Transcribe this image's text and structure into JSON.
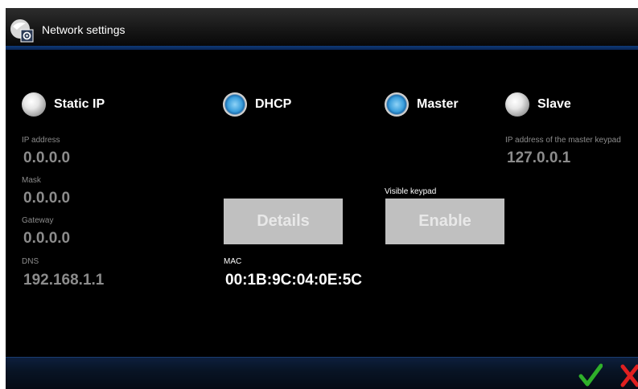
{
  "window": {
    "title": "Network settings"
  },
  "mode": {
    "static_ip": {
      "label": "Static IP",
      "selected": false
    },
    "dhcp": {
      "label": "DHCP",
      "selected": true
    }
  },
  "role": {
    "master": {
      "label": "Master",
      "selected": true
    },
    "slave": {
      "label": "Slave",
      "selected": false
    }
  },
  "fields": {
    "ip_address": {
      "label": "IP address",
      "value": "0.0.0.0"
    },
    "mask": {
      "label": "Mask",
      "value": "0.0.0.0"
    },
    "gateway": {
      "label": "Gateway",
      "value": "0.0.0.0"
    },
    "dns": {
      "label": "DNS",
      "value": "192.168.1.1"
    },
    "mac": {
      "label": "MAC",
      "value": "00:1B:9C:04:0E:5C"
    },
    "master_ip": {
      "label": "IP address of the master keypad",
      "value": "127.0.0.1"
    }
  },
  "visible_keypad": {
    "label": "Visible keypad"
  },
  "buttons": {
    "details": "Details",
    "enable": "Enable"
  },
  "icons": {
    "ok": "check-icon",
    "cancel": "close-icon",
    "app": "network-settings-icon"
  },
  "colors": {
    "accent": "#3a9edc",
    "ok": "#2fb02a",
    "cancel": "#e02020"
  }
}
